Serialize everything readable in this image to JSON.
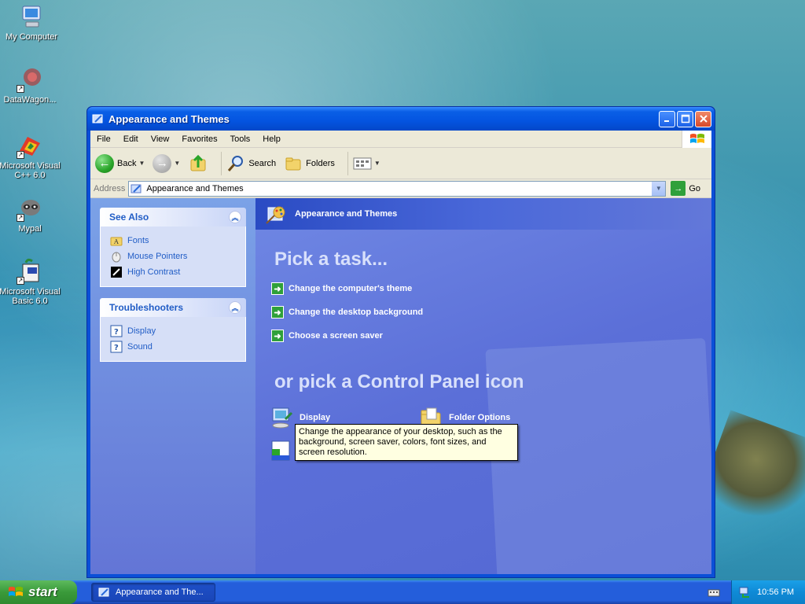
{
  "desktop": {
    "icons": [
      {
        "label": "My Computer"
      },
      {
        "label": "DataWagon..."
      },
      {
        "label": "Microsoft Visual C++ 6.0"
      },
      {
        "label": "Mypal"
      },
      {
        "label": "Microsoft Visual Basic 6.0"
      }
    ]
  },
  "window": {
    "title": "Appearance and Themes",
    "menu": [
      "File",
      "Edit",
      "View",
      "Favorites",
      "Tools",
      "Help"
    ],
    "toolbar": {
      "back_label": "Back",
      "search_label": "Search",
      "folders_label": "Folders"
    },
    "address": {
      "label": "Address",
      "value": "Appearance and Themes",
      "go_label": "Go"
    },
    "taskpane": {
      "see_also": {
        "title": "See Also",
        "items": [
          "Fonts",
          "Mouse Pointers",
          "High Contrast"
        ]
      },
      "troubleshooters": {
        "title": "Troubleshooters",
        "items": [
          "Display",
          "Sound"
        ]
      }
    },
    "main": {
      "header": "Appearance and Themes",
      "pick_task_heading": "Pick a task...",
      "tasks": [
        "Change the computer's theme",
        "Change the desktop background",
        "Choose a screen saver"
      ],
      "pick_icon_heading": "or pick a Control Panel icon",
      "icons": [
        "Display",
        "Folder Options"
      ],
      "tooltip": "Change the appearance of your desktop, such as the background, screen saver, colors, font sizes, and screen resolution."
    }
  },
  "taskbar": {
    "start_label": "start",
    "task_item": "Appearance and The...",
    "clock": "10:56 PM"
  },
  "colors": {
    "xp_blue": "#245edb",
    "start_green": "#3a9a3a",
    "task_link_blue": "#215dc6"
  }
}
